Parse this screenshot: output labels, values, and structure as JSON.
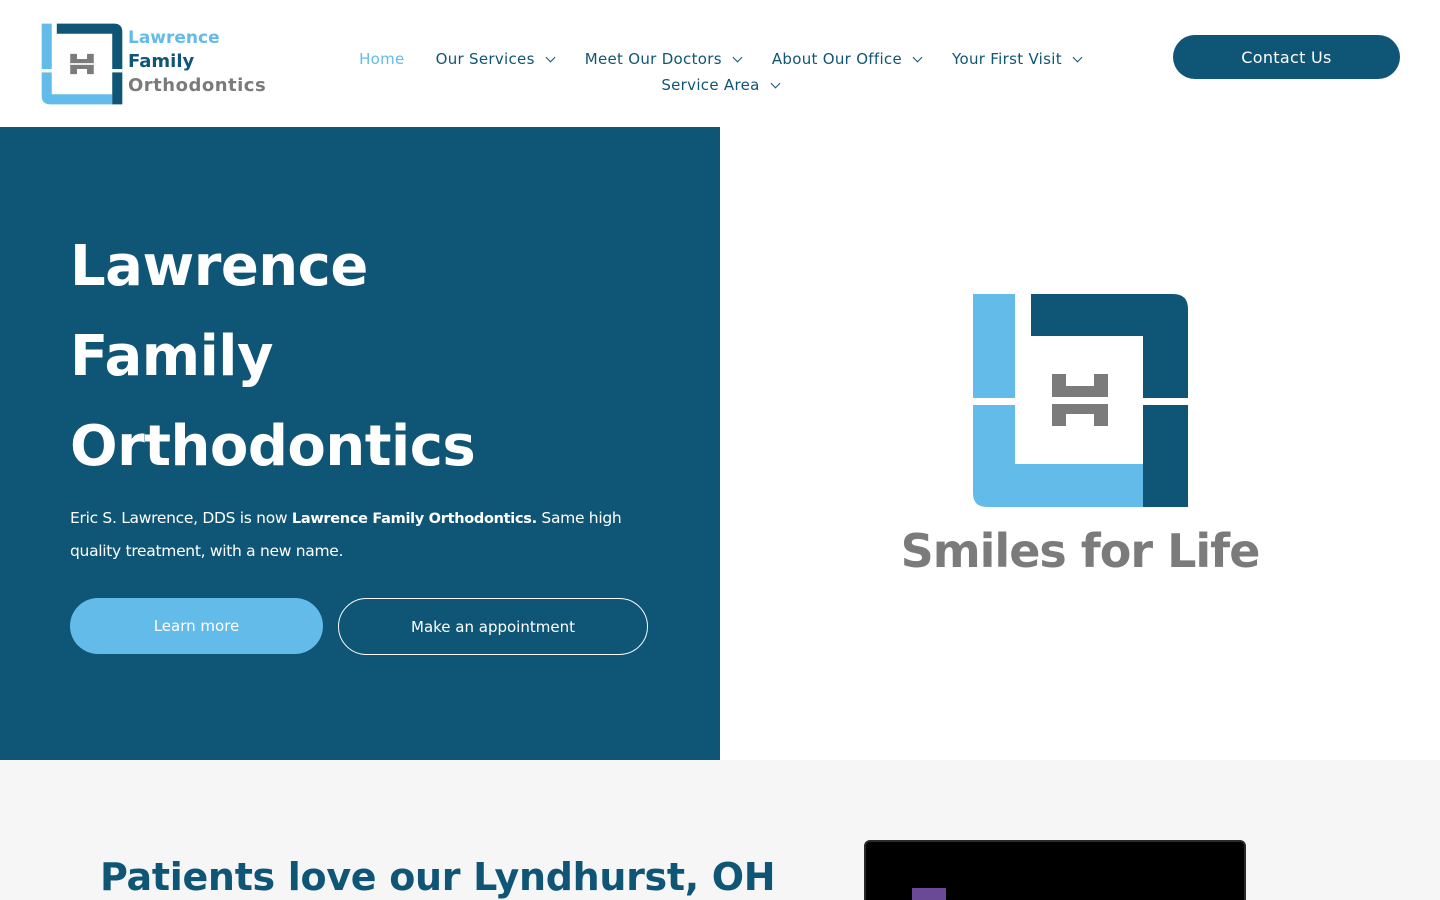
{
  "brand": {
    "logo_lines": [
      "Lawrence",
      "Family",
      "Orthodontics"
    ],
    "colors": {
      "primary": "#0f5575",
      "accent": "#63bbe9",
      "gray": "#7b7b7b"
    }
  },
  "nav": {
    "row1": [
      {
        "label": "Home",
        "active": true,
        "dropdown": false
      },
      {
        "label": "Our Services",
        "active": false,
        "dropdown": true
      },
      {
        "label": "Meet Our Doctors",
        "active": false,
        "dropdown": true
      },
      {
        "label": "About Our Office",
        "active": false,
        "dropdown": true
      },
      {
        "label": "Your First Visit",
        "active": false,
        "dropdown": true
      }
    ],
    "row2": [
      {
        "label": "Service Area",
        "active": false,
        "dropdown": true
      }
    ]
  },
  "header": {
    "contact_label": "Contact Us"
  },
  "hero": {
    "title_lines": [
      "Lawrence",
      "Family",
      "Orthodontics"
    ],
    "desc_prefix": "Eric S. Lawrence, DDS is now ",
    "desc_bold": "Lawrence Family Orthodontics.",
    "desc_suffix": "  Same high quality treatment, with a new name.",
    "learn_label": "Learn more",
    "appt_label": "Make an appointment",
    "tagline": "Smiles for Life",
    "icons": {
      "logo": "lfo-logo-mark",
      "chevron": "chevron-down-icon"
    }
  },
  "section2": {
    "heading": "Patients love our Lyndhurst, OH"
  }
}
